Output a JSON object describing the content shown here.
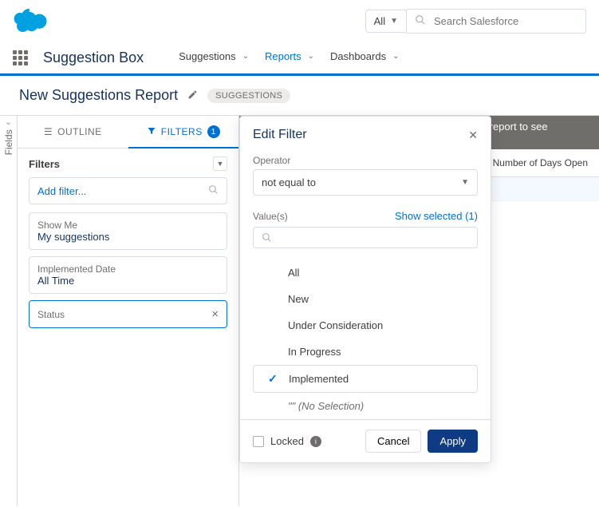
{
  "header": {
    "search_scope": "All",
    "search_placeholder": "Search Salesforce"
  },
  "nav": {
    "app_name": "Suggestion Box",
    "tabs": [
      "Suggestions",
      "Reports",
      "Dashboards"
    ],
    "active_index": 1
  },
  "page": {
    "title": "New Suggestions Report",
    "pill": "SUGGESTIONS"
  },
  "fields_rail_label": "Fields",
  "panel": {
    "tabs": {
      "outline": "OUTLINE",
      "filters": "FILTERS",
      "badge": "1"
    },
    "heading": "Filters",
    "add_placeholder": "Add filter...",
    "cards": [
      {
        "label": "Show Me",
        "value": "My suggestions"
      },
      {
        "label": "Implemented Date",
        "value": "All Time"
      }
    ],
    "selected_card": {
      "label": "Status"
    }
  },
  "notice": "Previewing a limited number of records. Run the report to see everything.",
  "column_header": "Number of Days Open",
  "popover": {
    "title": "Edit Filter",
    "operator_label": "Operator",
    "operator_value": "not equal to",
    "values_label": "Value(s)",
    "show_selected": "Show selected (1)",
    "options": [
      {
        "label": "All",
        "selected": false
      },
      {
        "label": "New",
        "selected": false
      },
      {
        "label": "Under Consideration",
        "selected": false
      },
      {
        "label": "In Progress",
        "selected": false
      },
      {
        "label": "Implemented",
        "selected": true
      },
      {
        "label": "\"\" (No Selection)",
        "selected": false,
        "italic": true
      }
    ],
    "locked_label": "Locked",
    "cancel": "Cancel",
    "apply": "Apply"
  }
}
